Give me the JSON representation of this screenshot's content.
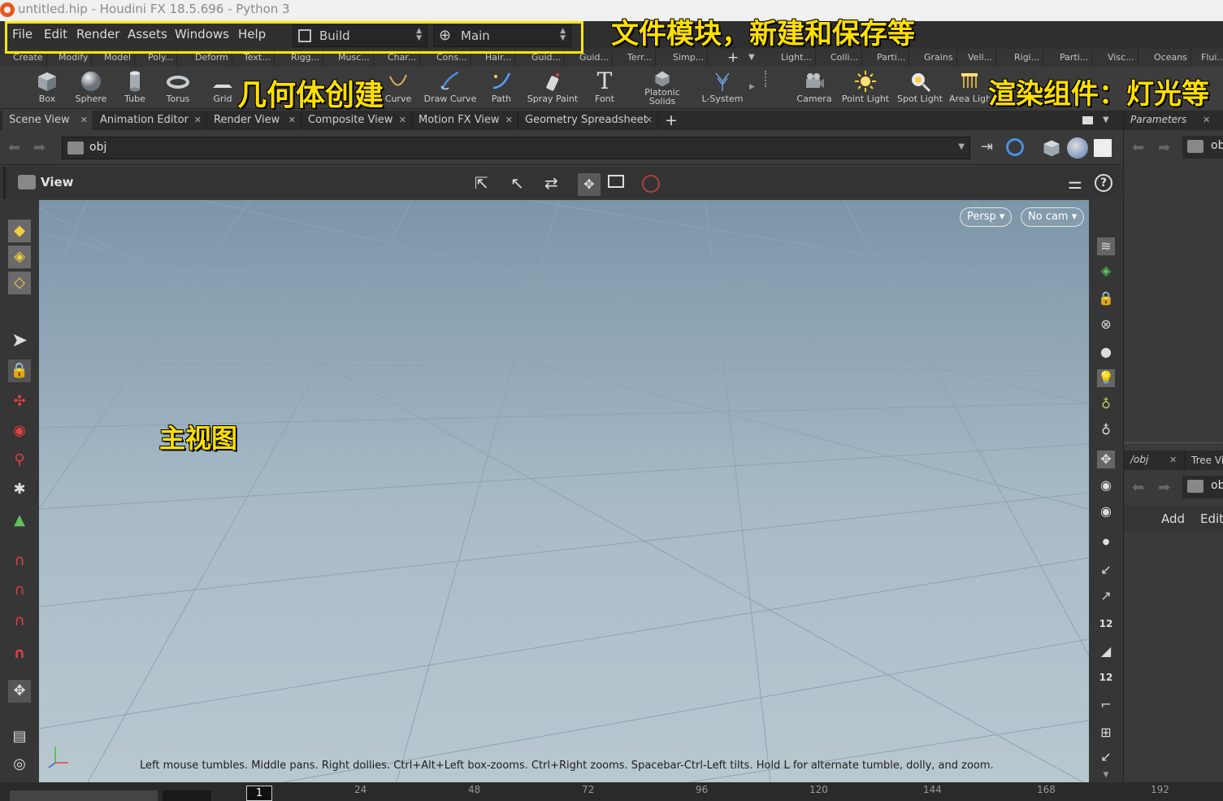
{
  "window": {
    "title": "untitled.hip - Houdini FX 18.5.696 - Python 3"
  },
  "menu": [
    "File",
    "Edit",
    "Render",
    "Assets",
    "Windows",
    "Help"
  ],
  "desktop": {
    "layout": "Build",
    "context": "Main"
  },
  "shelf_tabs_left": [
    "Create",
    "Modify",
    "Model",
    "Poly...",
    "Deform",
    "Text...",
    "Rigg...",
    "Musc...",
    "Char...",
    "Cons...",
    "Hair...",
    "Guid...",
    "Guid...",
    "Terr...",
    "Simp..."
  ],
  "shelf_tabs_right": [
    "Light...",
    "Colli...",
    "Parti...",
    "Grains",
    "Vell...",
    "Rigi...",
    "Parti...",
    "Visc...",
    "Oceans",
    "Flui..."
  ],
  "tools_left": [
    "Box",
    "Sphere",
    "Tube",
    "Torus",
    "Grid",
    "Curve",
    "Draw Curve",
    "Path",
    "Spray Paint",
    "Font",
    "Platonic Solids",
    "L-System"
  ],
  "tools_right": [
    "Camera",
    "Point Light",
    "Spot Light",
    "Area Light"
  ],
  "pane_tabs": [
    "Scene View",
    "Animation Editor",
    "Render View",
    "Composite View",
    "Motion FX View",
    "Geometry Spreadsheet"
  ],
  "path": {
    "node": "obj"
  },
  "view": {
    "label": "View",
    "persp": "Persp",
    "cam": "No cam",
    "hint": "Left mouse tumbles. Middle pans. Right dollies. Ctrl+Alt+Left box-zooms. Ctrl+Right zooms. Spacebar-Ctrl-Left tilts. Hold L for alternate tumble, dolly, and zoom."
  },
  "right_panel": {
    "tab1": "Parameters",
    "path": "ob",
    "tab2": "/obj",
    "tab3": "Tree Vi",
    "path2": "ob",
    "add": "Add",
    "edit": "Edit"
  },
  "timeline": {
    "frame": "1",
    "ticks": [
      "24",
      "48",
      "72",
      "96",
      "120",
      "144",
      "168",
      "192"
    ]
  },
  "annotations": {
    "file_module": "文件模块，新建和保存等",
    "geometry": "几何体创建",
    "render": "渲染组件：灯光等",
    "main_view": "主视图"
  },
  "colors": {
    "highlight": "#ffe600",
    "annotation": "#ffe000",
    "viewport_top": "#7c95a8",
    "viewport_bottom": "#b9c8cf"
  }
}
